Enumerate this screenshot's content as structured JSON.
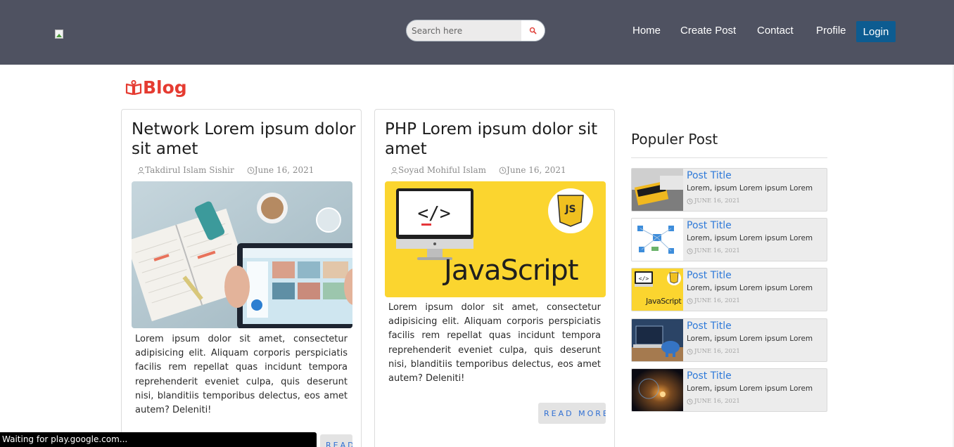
{
  "header": {
    "search_placeholder": "Search here",
    "nav": [
      "Home",
      "Create Post",
      "Contact",
      "Profile"
    ],
    "login_label": "Login"
  },
  "blog_heading": "Blog",
  "posts": [
    {
      "title": "Network Lorem ipsum dolor sit amet",
      "author": "Takdirul Islam Sishir",
      "date": "June 16, 2021",
      "excerpt": "Lorem ipsum dolor sit amet, consectetur adipisicing elit. Aliquam corporis perspiciatis facilis rem repellat quas incidunt tempora reprehenderit eveniet culpa, quis deserunt nisi, blanditiis temporibus delectus, eos amet autem? Deleniti!",
      "read_more": "READ MORE"
    },
    {
      "title": "PHP Lorem ipsum dolor sit amet",
      "author": "Soyad Mohiful Islam",
      "date": "June 16, 2021",
      "excerpt": "Lorem ipsum dolor sit amet, consectetur adipisicing elit. Aliquam corporis perspiciatis facilis rem repellat quas incidunt tempora reprehenderit eveniet culpa, quis deserunt nisi, blanditiis temporibus delectus, eos amet autem? Deleniti!",
      "read_more": "READ MORE",
      "image_caption": "JavaScript",
      "image_badge": "JS"
    }
  ],
  "sidebar": {
    "title": "Populer Post",
    "items": [
      {
        "title": "Post Title",
        "text": "Lorem, ipsum Lorem ipsum Lorem",
        "date": "JUNE 16, 2021"
      },
      {
        "title": "Post Title",
        "text": "Lorem, ipsum Lorem ipsum Lorem",
        "date": "JUNE 16, 2021"
      },
      {
        "title": "Post Title",
        "text": "Lorem, ipsum Lorem ipsum Lorem",
        "date": "JUNE 16, 2021",
        "thumb_caption": "JavaScript"
      },
      {
        "title": "Post Title",
        "text": "Lorem, ipsum Lorem ipsum Lorem",
        "date": "JUNE 16, 2021"
      },
      {
        "title": "Post Title",
        "text": "Lorem, ipsum Lorem ipsum Lorem",
        "date": "JUNE 16, 2021"
      }
    ]
  },
  "status_bar": "Waiting for play.google.com...",
  "colors": {
    "header_bg": "#4f5261",
    "login_bg": "#0d5c91",
    "blog_accent": "#e53b31",
    "link_blue": "#2f7ad9",
    "js_yellow": "#fbd52f"
  }
}
